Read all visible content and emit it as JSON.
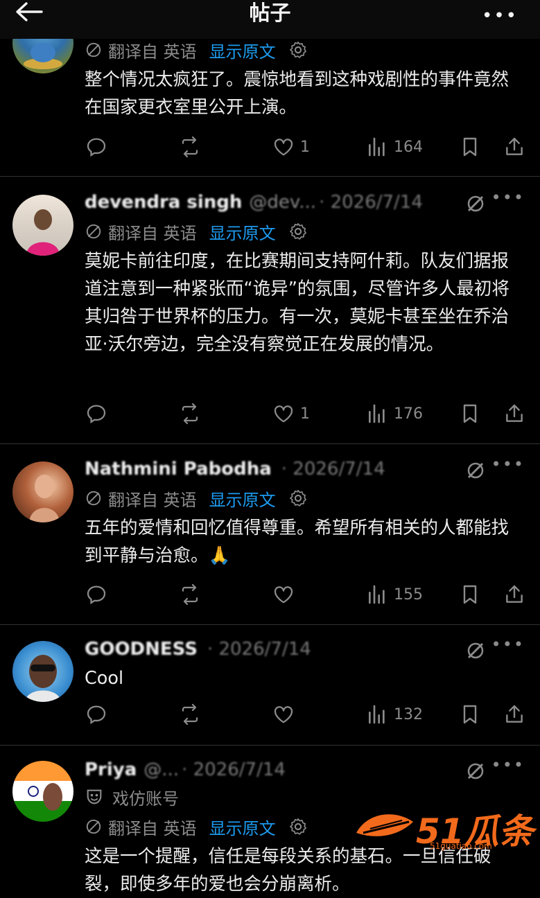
{
  "header": {
    "title": "帖子",
    "more": "•••"
  },
  "translate": {
    "label": "翻译自 英语",
    "show_original": "显示原文"
  },
  "posts": [
    {
      "name": "",
      "handle": "",
      "date": "",
      "body": "整个情况太疯狂了。震惊地看到这种戏剧性的事件竟然在国家更衣室里公开上演。",
      "likes": "1",
      "views": "164"
    },
    {
      "name": "devendra singh",
      "handle": "@dev...",
      "date": "· 2026/7/14",
      "body": "莫妮卡前往印度，在比赛期间支持阿什莉。队友们据报道注意到一种紧张而“诡异”的氛围，尽管许多人最初将其归咎于世界杯的压力。有一次，莫妮卡甚至坐在乔治亚·沃尔旁边，完全没有察觉正在发展的情况。",
      "likes": "1",
      "views": "176"
    },
    {
      "name": "Nathmini Pabodha",
      "handle": "",
      "date": "· 2026/7/14",
      "body": "五年的爱情和回忆值得尊重。希望所有相关的人都能找到平静与治愈。🙏",
      "likes": "",
      "views": "155"
    },
    {
      "name": "GOODNESS",
      "handle": "",
      "date": "· 2026/7/14",
      "body": "Cool",
      "likes": "",
      "views": "132"
    },
    {
      "name": "Priya",
      "handle": "@...",
      "date": "· 2026/7/14",
      "parody": "戏仿账号",
      "body": "这是一个提醒，信任是每段关系的基石。一旦信任破裂，即使多年的爱也会分崩离析。",
      "likes": "",
      "views": ""
    }
  ],
  "watermark": {
    "text": "51瓜条",
    "url": "51guatiao.com"
  },
  "colors": {
    "background": "#000000",
    "accent": "#1d9bf0",
    "muted": "#8b8b8b",
    "watermark": "#f26a1b"
  }
}
